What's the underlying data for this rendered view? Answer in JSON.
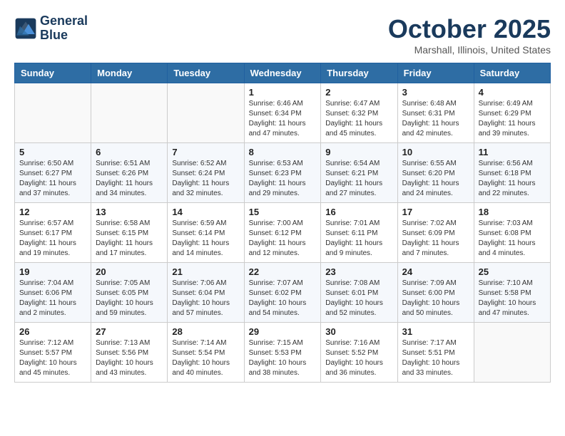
{
  "header": {
    "logo_line1": "General",
    "logo_line2": "Blue",
    "month": "October 2025",
    "location": "Marshall, Illinois, United States"
  },
  "weekdays": [
    "Sunday",
    "Monday",
    "Tuesday",
    "Wednesday",
    "Thursday",
    "Friday",
    "Saturday"
  ],
  "weeks": [
    [
      {
        "day": "",
        "info": ""
      },
      {
        "day": "",
        "info": ""
      },
      {
        "day": "",
        "info": ""
      },
      {
        "day": "1",
        "info": "Sunrise: 6:46 AM\nSunset: 6:34 PM\nDaylight: 11 hours\nand 47 minutes."
      },
      {
        "day": "2",
        "info": "Sunrise: 6:47 AM\nSunset: 6:32 PM\nDaylight: 11 hours\nand 45 minutes."
      },
      {
        "day": "3",
        "info": "Sunrise: 6:48 AM\nSunset: 6:31 PM\nDaylight: 11 hours\nand 42 minutes."
      },
      {
        "day": "4",
        "info": "Sunrise: 6:49 AM\nSunset: 6:29 PM\nDaylight: 11 hours\nand 39 minutes."
      }
    ],
    [
      {
        "day": "5",
        "info": "Sunrise: 6:50 AM\nSunset: 6:27 PM\nDaylight: 11 hours\nand 37 minutes."
      },
      {
        "day": "6",
        "info": "Sunrise: 6:51 AM\nSunset: 6:26 PM\nDaylight: 11 hours\nand 34 minutes."
      },
      {
        "day": "7",
        "info": "Sunrise: 6:52 AM\nSunset: 6:24 PM\nDaylight: 11 hours\nand 32 minutes."
      },
      {
        "day": "8",
        "info": "Sunrise: 6:53 AM\nSunset: 6:23 PM\nDaylight: 11 hours\nand 29 minutes."
      },
      {
        "day": "9",
        "info": "Sunrise: 6:54 AM\nSunset: 6:21 PM\nDaylight: 11 hours\nand 27 minutes."
      },
      {
        "day": "10",
        "info": "Sunrise: 6:55 AM\nSunset: 6:20 PM\nDaylight: 11 hours\nand 24 minutes."
      },
      {
        "day": "11",
        "info": "Sunrise: 6:56 AM\nSunset: 6:18 PM\nDaylight: 11 hours\nand 22 minutes."
      }
    ],
    [
      {
        "day": "12",
        "info": "Sunrise: 6:57 AM\nSunset: 6:17 PM\nDaylight: 11 hours\nand 19 minutes."
      },
      {
        "day": "13",
        "info": "Sunrise: 6:58 AM\nSunset: 6:15 PM\nDaylight: 11 hours\nand 17 minutes."
      },
      {
        "day": "14",
        "info": "Sunrise: 6:59 AM\nSunset: 6:14 PM\nDaylight: 11 hours\nand 14 minutes."
      },
      {
        "day": "15",
        "info": "Sunrise: 7:00 AM\nSunset: 6:12 PM\nDaylight: 11 hours\nand 12 minutes."
      },
      {
        "day": "16",
        "info": "Sunrise: 7:01 AM\nSunset: 6:11 PM\nDaylight: 11 hours\nand 9 minutes."
      },
      {
        "day": "17",
        "info": "Sunrise: 7:02 AM\nSunset: 6:09 PM\nDaylight: 11 hours\nand 7 minutes."
      },
      {
        "day": "18",
        "info": "Sunrise: 7:03 AM\nSunset: 6:08 PM\nDaylight: 11 hours\nand 4 minutes."
      }
    ],
    [
      {
        "day": "19",
        "info": "Sunrise: 7:04 AM\nSunset: 6:06 PM\nDaylight: 11 hours\nand 2 minutes."
      },
      {
        "day": "20",
        "info": "Sunrise: 7:05 AM\nSunset: 6:05 PM\nDaylight: 10 hours\nand 59 minutes."
      },
      {
        "day": "21",
        "info": "Sunrise: 7:06 AM\nSunset: 6:04 PM\nDaylight: 10 hours\nand 57 minutes."
      },
      {
        "day": "22",
        "info": "Sunrise: 7:07 AM\nSunset: 6:02 PM\nDaylight: 10 hours\nand 54 minutes."
      },
      {
        "day": "23",
        "info": "Sunrise: 7:08 AM\nSunset: 6:01 PM\nDaylight: 10 hours\nand 52 minutes."
      },
      {
        "day": "24",
        "info": "Sunrise: 7:09 AM\nSunset: 6:00 PM\nDaylight: 10 hours\nand 50 minutes."
      },
      {
        "day": "25",
        "info": "Sunrise: 7:10 AM\nSunset: 5:58 PM\nDaylight: 10 hours\nand 47 minutes."
      }
    ],
    [
      {
        "day": "26",
        "info": "Sunrise: 7:12 AM\nSunset: 5:57 PM\nDaylight: 10 hours\nand 45 minutes."
      },
      {
        "day": "27",
        "info": "Sunrise: 7:13 AM\nSunset: 5:56 PM\nDaylight: 10 hours\nand 43 minutes."
      },
      {
        "day": "28",
        "info": "Sunrise: 7:14 AM\nSunset: 5:54 PM\nDaylight: 10 hours\nand 40 minutes."
      },
      {
        "day": "29",
        "info": "Sunrise: 7:15 AM\nSunset: 5:53 PM\nDaylight: 10 hours\nand 38 minutes."
      },
      {
        "day": "30",
        "info": "Sunrise: 7:16 AM\nSunset: 5:52 PM\nDaylight: 10 hours\nand 36 minutes."
      },
      {
        "day": "31",
        "info": "Sunrise: 7:17 AM\nSunset: 5:51 PM\nDaylight: 10 hours\nand 33 minutes."
      },
      {
        "day": "",
        "info": ""
      }
    ]
  ]
}
